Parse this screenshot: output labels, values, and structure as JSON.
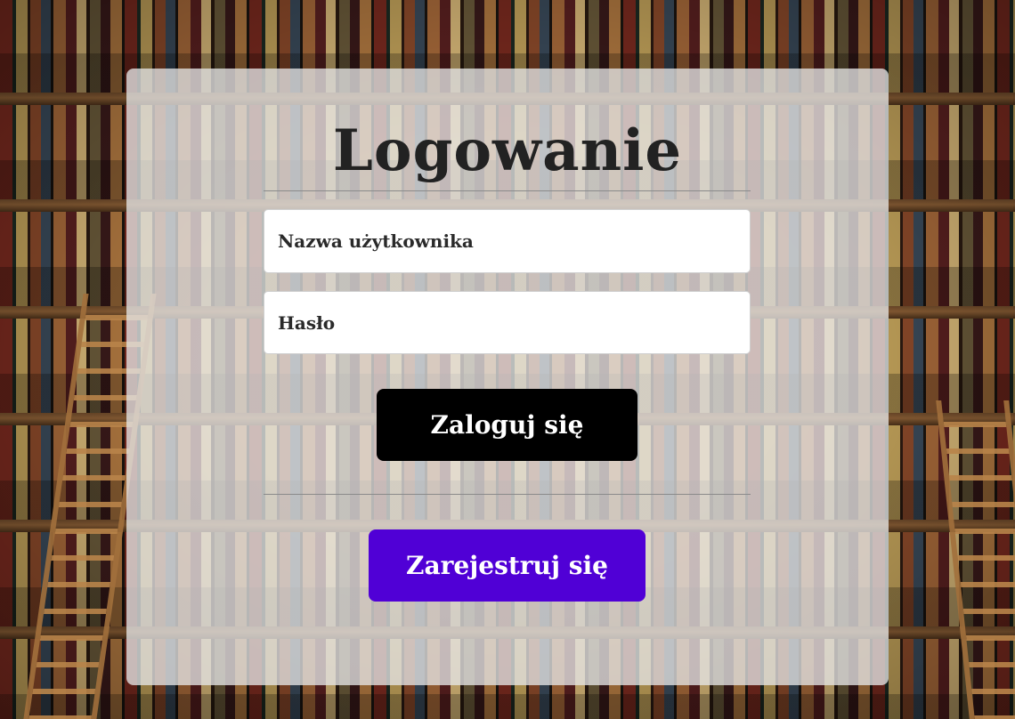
{
  "login_form": {
    "title": "Logowanie",
    "username_placeholder": "Nazwa użytkownika",
    "password_placeholder": "Hasło",
    "login_button_label": "Zaloguj się",
    "register_button_label": "Zarejestruj się"
  },
  "colors": {
    "login_button": "#000000",
    "register_button": "#5000d6",
    "card_background": "rgba(230,230,230,0.78)",
    "title_text": "#222222"
  }
}
